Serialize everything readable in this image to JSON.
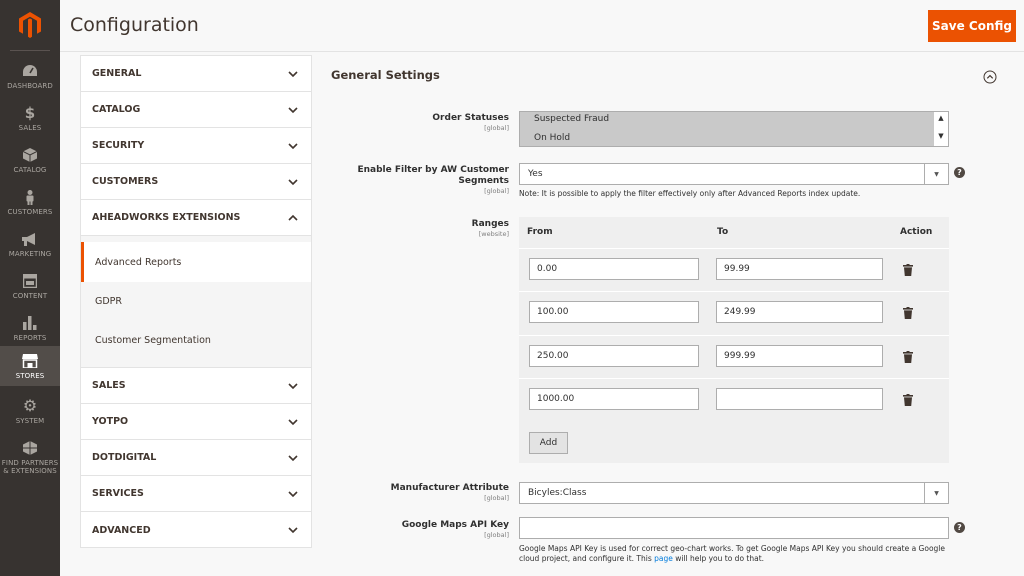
{
  "nav": {
    "items": [
      {
        "label": "DASHBOARD",
        "icon": "dashboard-icon"
      },
      {
        "label": "SALES",
        "icon": "dollar-icon"
      },
      {
        "label": "CATALOG",
        "icon": "box-icon"
      },
      {
        "label": "CUSTOMERS",
        "icon": "person-icon"
      },
      {
        "label": "MARKETING",
        "icon": "megaphone-icon"
      },
      {
        "label": "CONTENT",
        "icon": "layout-icon"
      },
      {
        "label": "REPORTS",
        "icon": "bar-chart-icon"
      },
      {
        "label": "STORES",
        "icon": "store-icon"
      },
      {
        "label": "SYSTEM",
        "icon": "gear-icon"
      },
      {
        "label": "FIND PARTNERS & EXTENSIONS",
        "icon": "cubes-icon"
      }
    ]
  },
  "header": {
    "title": "Configuration",
    "save_label": "Save Config",
    "accent": "#eb5202"
  },
  "tabs": {
    "items": [
      {
        "label": "GENERAL"
      },
      {
        "label": "CATALOG"
      },
      {
        "label": "SECURITY"
      },
      {
        "label": "CUSTOMERS"
      },
      {
        "label": "AHEADWORKS EXTENSIONS"
      },
      {
        "label": "SALES"
      },
      {
        "label": "YOTPO"
      },
      {
        "label": "DOTDIGITAL"
      },
      {
        "label": "SERVICES"
      },
      {
        "label": "ADVANCED"
      }
    ],
    "sub_items": [
      {
        "label": "Advanced Reports"
      },
      {
        "label": "GDPR"
      },
      {
        "label": "Customer Segmentation"
      }
    ]
  },
  "section": {
    "title": "General Settings"
  },
  "fields": {
    "order_statuses": {
      "label": "Order Statuses",
      "scope": "[global]",
      "options": [
        "Suspected Fraud",
        "On Hold"
      ]
    },
    "enable_filter": {
      "label": "Enable Filter by AW Customer Segments",
      "scope": "[global]",
      "value": "Yes",
      "note": "Note: It is possible to apply the filter effectively only after Advanced Reports index update."
    },
    "ranges": {
      "label": "Ranges",
      "scope": "[website]",
      "col_from": "From",
      "col_to": "To",
      "col_action": "Action",
      "rows": [
        {
          "from": "0.00",
          "to": "99.99"
        },
        {
          "from": "100.00",
          "to": "249.99"
        },
        {
          "from": "250.00",
          "to": "999.99"
        },
        {
          "from": "1000.00",
          "to": ""
        }
      ],
      "add_label": "Add"
    },
    "manufacturer": {
      "label": "Manufacturer Attribute",
      "scope": "[global]",
      "value": "Bicyles:Class"
    },
    "gmaps": {
      "label": "Google Maps API Key",
      "scope": "[global]",
      "value": "",
      "note_line1": "Google Maps API Key is used for correct geo-chart works. To get Google Maps API Key you should create a Google",
      "note_line2_a": "cloud project, and configure it. This ",
      "note_link": "page",
      "note_line2_b": " will help you to do that."
    }
  }
}
